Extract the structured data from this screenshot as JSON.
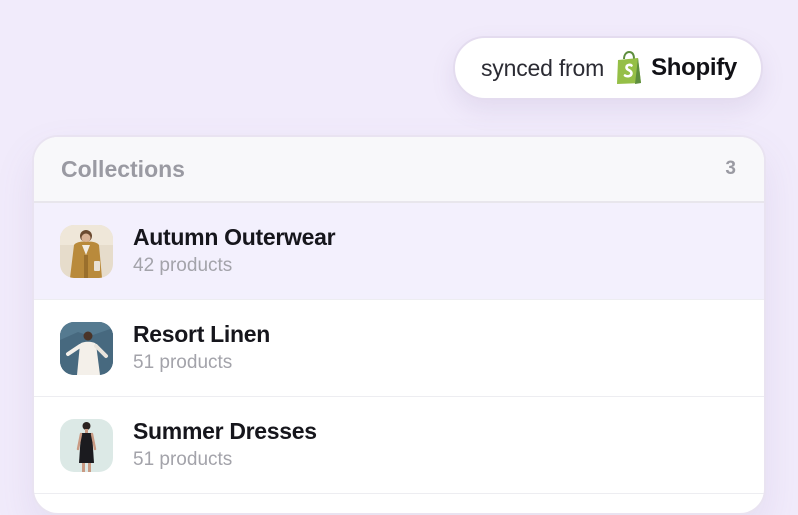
{
  "sync_badge": {
    "text": "synced from",
    "brand": "Shopify",
    "brand_icon": "shopify-bag-icon",
    "brand_color": "#95bf47"
  },
  "collections": {
    "title": "Collections",
    "count": "3",
    "items": [
      {
        "name": "Autumn Outerwear",
        "count": "42 products",
        "thumb_icon": "outerwear-photo",
        "selected": true
      },
      {
        "name": "Resort Linen",
        "count": "51 products",
        "thumb_icon": "linen-photo",
        "selected": false
      },
      {
        "name": "Summer Dresses",
        "count": "51 products",
        "thumb_icon": "dress-photo",
        "selected": false
      }
    ]
  }
}
